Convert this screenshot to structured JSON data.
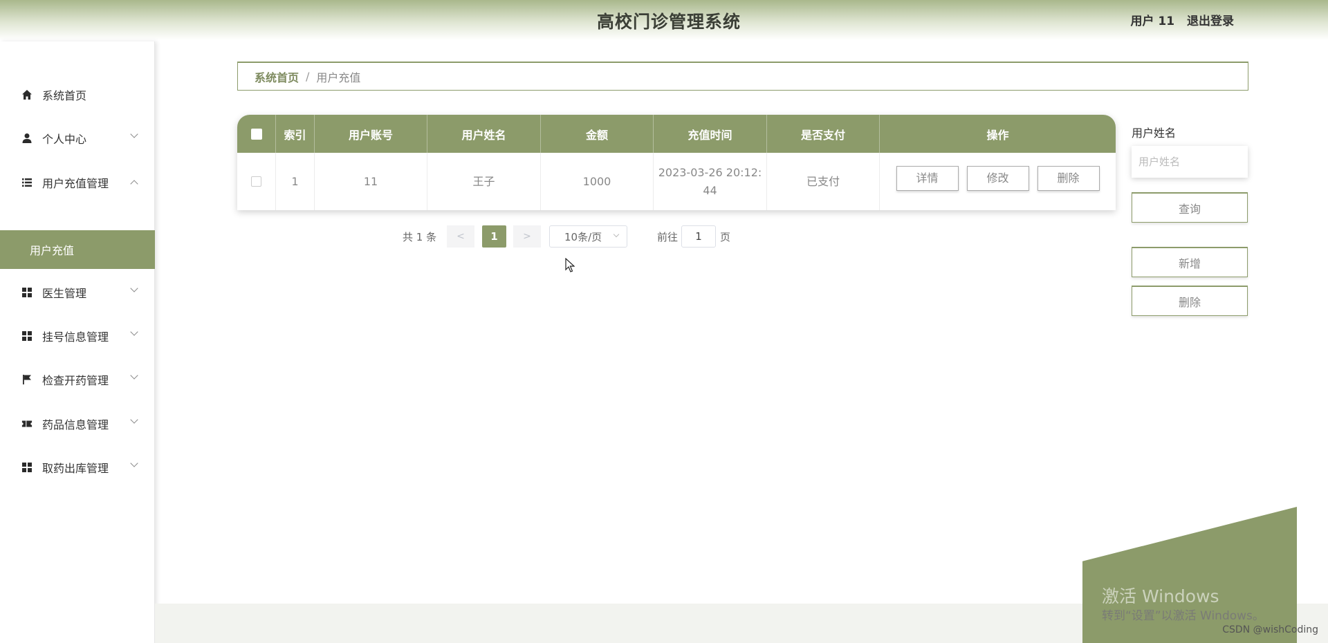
{
  "header": {
    "title": "高校门诊管理系统",
    "user": "用户 11",
    "logout": "退出登录"
  },
  "sidebar": {
    "items": [
      {
        "label": "系统首页",
        "icon": "home-icon"
      },
      {
        "label": "个人中心",
        "icon": "user-icon"
      },
      {
        "label": "用户充值管理",
        "icon": "list-icon"
      },
      {
        "label": "医生管理",
        "icon": "grid-icon"
      },
      {
        "label": "挂号信息管理",
        "icon": "grid-icon"
      },
      {
        "label": "检查开药管理",
        "icon": "flag-icon"
      },
      {
        "label": "药品信息管理",
        "icon": "ticket-icon"
      },
      {
        "label": "取药出库管理",
        "icon": "grid-icon"
      }
    ],
    "active_sub": "用户充值"
  },
  "breadcrumb": {
    "home": "系统首页",
    "sep": "/",
    "current": "用户充值"
  },
  "table": {
    "headers": [
      "索引",
      "用户账号",
      "用户姓名",
      "金额",
      "充值时间",
      "是否支付",
      "操作"
    ],
    "rows": [
      {
        "index": "1",
        "account": "11",
        "name": "王子",
        "amount": "1000",
        "time_line1": "2023-03-26 20:12:",
        "time_line2": "44",
        "paid": "已支付"
      }
    ],
    "actions": {
      "detail": "详情",
      "edit": "修改",
      "delete": "删除"
    }
  },
  "pagination": {
    "total": "共 1 条",
    "prev": "<",
    "next": ">",
    "current": "1",
    "page_size": "10条/页",
    "goto_label": "前往",
    "goto_value": "1",
    "goto_suffix": "页"
  },
  "search": {
    "label": "用户姓名",
    "placeholder": "用户姓名",
    "query_button": "查询",
    "add_button": "新增",
    "delete_button": "删除"
  },
  "watermark": {
    "line1": "激活 Windows",
    "line2": "转到“设置”以激活 Windows。",
    "credit": "CSDN @wishCoding"
  },
  "colors": {
    "accent": "#8c9b6a"
  }
}
